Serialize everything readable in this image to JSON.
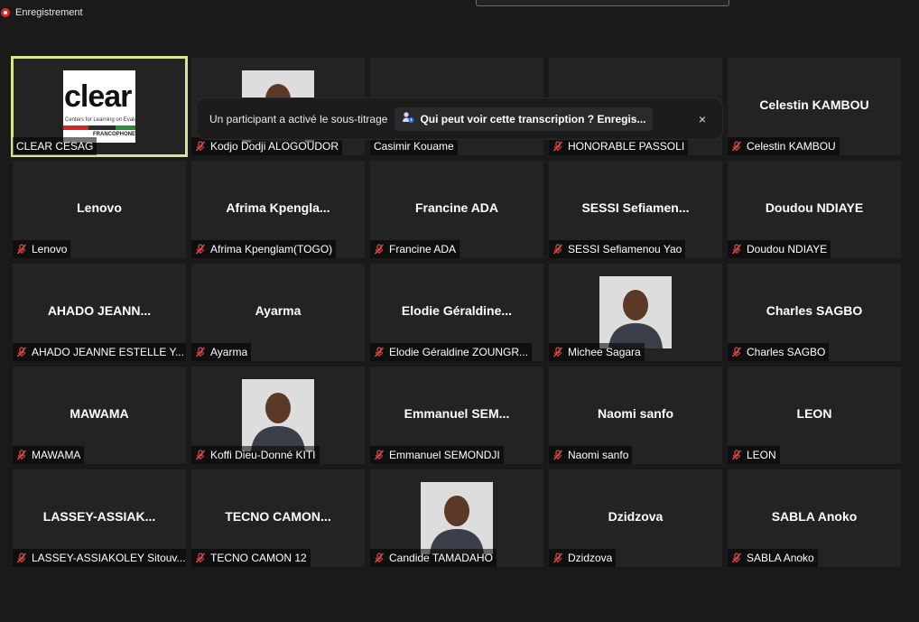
{
  "recording": {
    "label": "Enregistrement"
  },
  "notification": {
    "message": "Un participant a activé le sous-titrage",
    "link_text": "Qui peut voir cette transcription ? Enregis...",
    "close": "×"
  },
  "participants": [
    {
      "title": "",
      "name": "CLEAR CESAG",
      "muted": false,
      "media": "logo",
      "active": true,
      "logo_word": "clear",
      "logo_sub": "Centers for Learning on Evaluation",
      "logo_band": "FRANCOPHONE"
    },
    {
      "title": "",
      "name": "Kodjo Dodji ALOGOUDOR",
      "muted": true,
      "media": "photo"
    },
    {
      "title": "Casimir Kouame",
      "name": "Casimir Kouame",
      "muted": false,
      "media": "text"
    },
    {
      "title": "HONORABLE PA...",
      "name": "HONORABLE PASSOLI",
      "muted": true,
      "media": "text"
    },
    {
      "title": "Celestin KAMBOU",
      "name": "Celestin KAMBOU",
      "muted": true,
      "media": "text"
    },
    {
      "title": "Lenovo",
      "name": "Lenovo",
      "muted": true,
      "media": "text"
    },
    {
      "title": "Afrima Kpengla...",
      "name": "Afrima Kpenglam(TOGO)",
      "muted": true,
      "media": "text"
    },
    {
      "title": "Francine ADA",
      "name": "Francine ADA",
      "muted": true,
      "media": "text"
    },
    {
      "title": "SESSI Sefiamen...",
      "name": "SESSI Sefiamenou Yao",
      "muted": true,
      "media": "text"
    },
    {
      "title": "Doudou NDIAYE",
      "name": "Doudou NDIAYE",
      "muted": true,
      "media": "text"
    },
    {
      "title": "AHADO JEANN...",
      "name": "AHADO JEANNE ESTELLE Y...",
      "muted": true,
      "media": "text"
    },
    {
      "title": "Ayarma",
      "name": "Ayarma",
      "muted": true,
      "media": "text"
    },
    {
      "title": "Elodie Géraldine...",
      "name": "Elodie Géraldine ZOUNGR...",
      "muted": true,
      "media": "text"
    },
    {
      "title": "",
      "name": "Michee Sagara",
      "muted": true,
      "media": "photo"
    },
    {
      "title": "Charles SAGBO",
      "name": "Charles SAGBO",
      "muted": true,
      "media": "text"
    },
    {
      "title": "MAWAMA",
      "name": "MAWAMA",
      "muted": true,
      "media": "text"
    },
    {
      "title": "",
      "name": "Koffi Dieu-Donné KITI",
      "muted": true,
      "media": "photo"
    },
    {
      "title": "Emmanuel SEM...",
      "name": "Emmanuel SEMONDJI",
      "muted": true,
      "media": "text"
    },
    {
      "title": "Naomi sanfo",
      "name": "Naomi sanfo",
      "muted": true,
      "media": "text"
    },
    {
      "title": "LEON",
      "name": "LEON",
      "muted": true,
      "media": "text"
    },
    {
      "title": "LASSEY-ASSIAK...",
      "name": "LASSEY-ASSIAKOLEY Sitouv...",
      "muted": true,
      "media": "text"
    },
    {
      "title": "TECNO CAMON...",
      "name": "TECNO CAMON 12",
      "muted": true,
      "media": "text"
    },
    {
      "title": "",
      "name": "Candide TAMADAHO",
      "muted": true,
      "media": "photo"
    },
    {
      "title": "Dzidzova",
      "name": "Dzidzova",
      "muted": true,
      "media": "text"
    },
    {
      "title": "SABLA Anoko",
      "name": "SABLA Anoko",
      "muted": true,
      "media": "text"
    }
  ],
  "colors": {
    "background": "#1a1a1a",
    "tile": "#232323",
    "active_speaker": "#d8e58b",
    "mute": "#e04b4b"
  }
}
